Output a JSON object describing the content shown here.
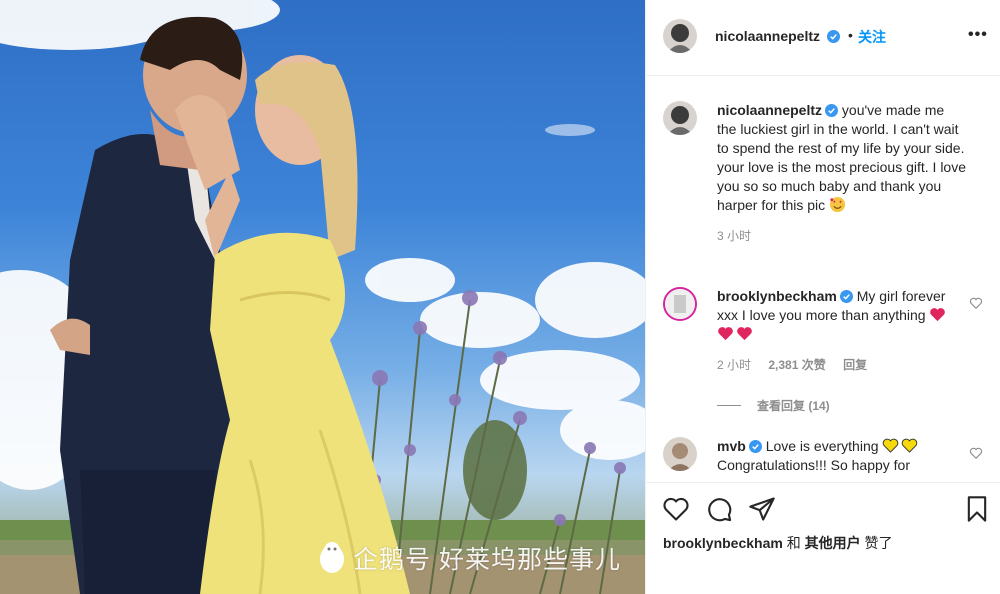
{
  "post": {
    "username": "nicolaannepeltz",
    "dot": "•",
    "follow_label": "关注",
    "more_label": "•••"
  },
  "caption": {
    "username": "nicolaannepeltz",
    "text": "you've made me the luckiest girl in the world. I can't wait to spend the rest of my life by your side. your love is the most precious gift. I love you so so much baby and thank you harper for this pic",
    "time": "3 小时"
  },
  "comments": [
    {
      "username": "brooklynbeckham",
      "text": "My girl forever xxx I love you more than anything",
      "time": "2 小时",
      "likes": "2,381 次赞",
      "reply": "回复",
      "view_replies": "查看回复 (14)"
    },
    {
      "username": "mvb",
      "text": "Love is everything",
      "text2": "Congratulations!!! So happy for"
    }
  ],
  "likes_line": {
    "user": "brooklynbeckham",
    "and": "和",
    "others": "其他用户",
    "suffix": "赞了"
  },
  "watermark": {
    "text": "企鹅号 好莱坞那些事儿"
  },
  "icons": [
    "verified-icon",
    "more-icon",
    "heart-icon",
    "comment-icon",
    "share-icon",
    "bookmark-icon"
  ],
  "colors": {
    "accent": "#0095f6",
    "text": "#262626",
    "muted": "#8e8e8e",
    "heart": "#e0245e",
    "emoji_yellow": "#f5d90a"
  }
}
